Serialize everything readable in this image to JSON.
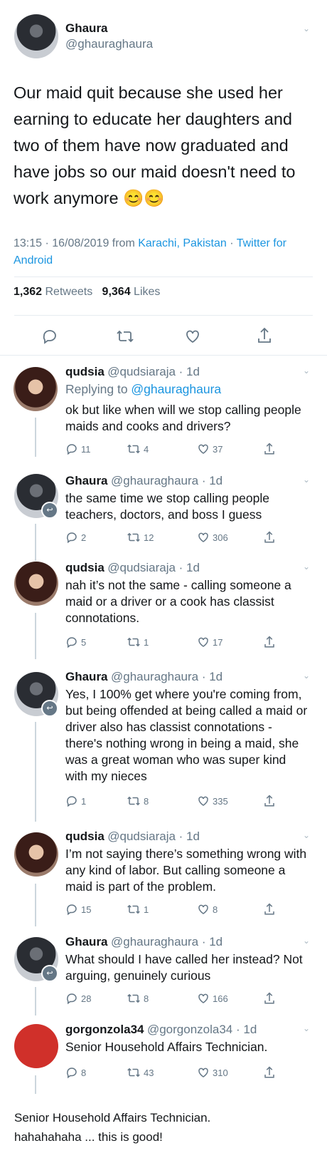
{
  "main_tweet": {
    "name": "Ghaura",
    "handle": "@ghauraghaura",
    "text": "Our maid quit because she used her earning to educate her daughters and two of them have now graduated and have jobs so our maid doesn't need to work anymore 😊😊",
    "time": "13:15 · 16/08/2019 from ",
    "location": "Karachi, Pakistan",
    "sep": " · ",
    "source": "Twitter for Android",
    "retweets_count": "1,362",
    "retweets_label": "Retweets",
    "likes_count": "9,364",
    "likes_label": "Likes"
  },
  "replies": [
    {
      "name": "qudsia",
      "handle": "@qudsiaraja · 1d",
      "replying_prefix": "Replying to ",
      "replying_to": "@ghauraghaura",
      "text": "ok but like when will we stop calling people maids and cooks and drivers?",
      "replies": "11",
      "retweets": "4",
      "likes": "37"
    },
    {
      "name": "Ghaura",
      "handle": "@ghauraghaura · 1d",
      "text": "the same time we stop calling people teachers, doctors, and boss I guess",
      "replies": "2",
      "retweets": "12",
      "likes": "306"
    },
    {
      "name": "qudsia",
      "handle": "@qudsiaraja · 1d",
      "text": "nah it’s not the same - calling someone a maid or a driver or a cook has classist connotations.",
      "replies": "5",
      "retweets": "1",
      "likes": "17"
    },
    {
      "name": "Ghaura",
      "handle": "@ghauraghaura · 1d",
      "text": "Yes, I 100% get where you're coming from, but being offended at being called a maid or driver also has classist connotations - there's nothing wrong in being a maid, she was a great woman who was super kind with my nieces",
      "replies": "1",
      "retweets": "8",
      "likes": "335"
    },
    {
      "name": "qudsia",
      "handle": "@qudsiaraja · 1d",
      "text": "I’m not saying there’s something wrong with any kind of labor. But calling someone a maid is part of the problem.",
      "replies": "15",
      "retweets": "1",
      "likes": "8"
    },
    {
      "name": "Ghaura",
      "handle": "@ghauraghaura · 1d",
      "text": "What should I have called her instead? Not arguing, genuinely curious",
      "replies": "28",
      "retweets": "8",
      "likes": "166"
    },
    {
      "name": "gorgonzola34",
      "handle": "@gorgonzola34 · 1d",
      "text": "Senior Household Affairs Technician.",
      "replies": "8",
      "retweets": "43",
      "likes": "310"
    }
  ],
  "caption": "Senior Household Affairs Technician. hahahahaha ... this is good!",
  "colors": {
    "link": "#1b95e0",
    "secondary": "#657786",
    "gorgonzola_avatar": "#d0302a"
  },
  "icons": [
    "reply-icon",
    "retweet-icon",
    "like-icon",
    "share-icon",
    "chevron-down-icon",
    "reply-badge-icon"
  ]
}
